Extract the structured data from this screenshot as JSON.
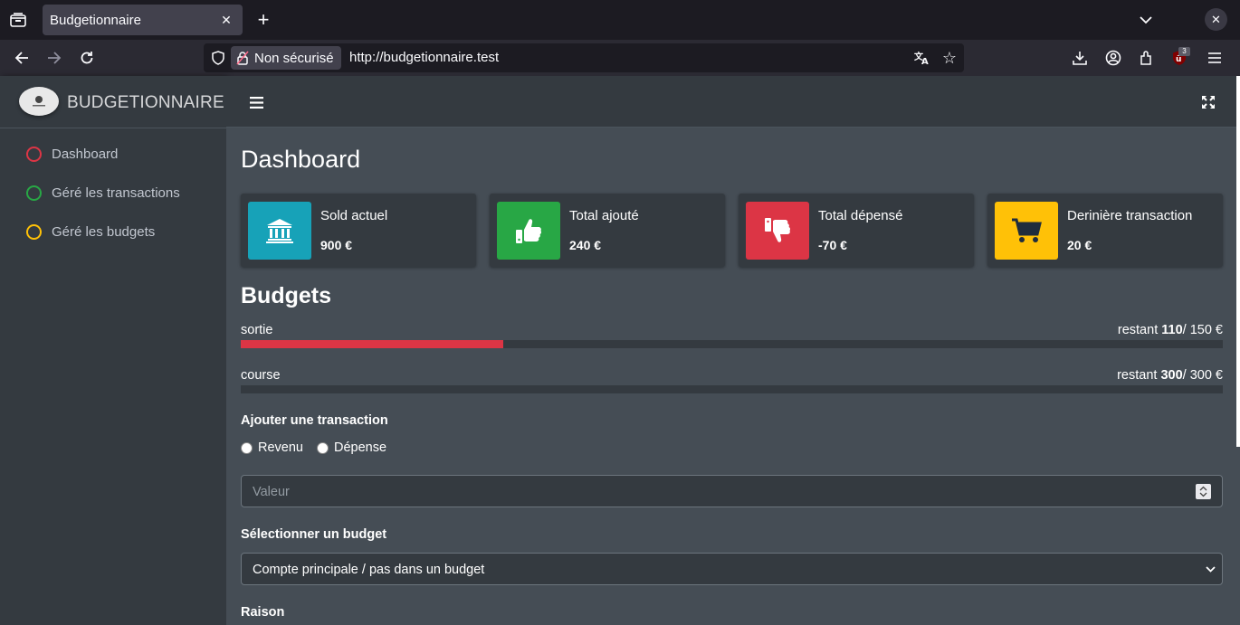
{
  "browser": {
    "tab_title": "Budgetionnaire",
    "security_label": "Non sécurisé",
    "url": "http://budgetionnaire.test",
    "extension_badge": "3"
  },
  "sidebar": {
    "brand": "BUDGETIONNAIRE",
    "items": [
      {
        "label": "Dashboard",
        "color": "#dc3545"
      },
      {
        "label": "Géré les transactions",
        "color": "#28a745"
      },
      {
        "label": "Géré les budgets",
        "color": "#ffc107"
      }
    ]
  },
  "main": {
    "page_title": "Dashboard",
    "info_boxes": [
      {
        "label": "Sold actuel",
        "value": "900 €",
        "color": "#17a2b8",
        "icon": "bank-icon"
      },
      {
        "label": "Total ajouté",
        "value": "240 €",
        "color": "#28a745",
        "icon": "thumbs-up-icon"
      },
      {
        "label": "Total dépensé",
        "value": "-70 €",
        "color": "#dc3545",
        "icon": "thumbs-down-icon"
      },
      {
        "label": "Derinière transaction",
        "value": "20 €",
        "color": "#ffc107",
        "icon": "cart-icon"
      }
    ],
    "budgets_title": "Budgets",
    "budgets": [
      {
        "name": "sortie",
        "remaining_prefix": "restant ",
        "remaining": "110",
        "total": "/ 150 €",
        "spent_fraction": 0.267
      },
      {
        "name": "course",
        "remaining_prefix": "restant ",
        "remaining": "300",
        "total": "/ 300 €",
        "spent_fraction": 0.0
      }
    ],
    "form": {
      "title": "Ajouter une transaction",
      "radio_income": "Revenu",
      "radio_expense": "Dépense",
      "value_placeholder": "Valeur",
      "budget_label": "Sélectionner un budget",
      "budget_selected": "Compte principale / pas dans un budget",
      "reason_label": "Raison"
    }
  }
}
